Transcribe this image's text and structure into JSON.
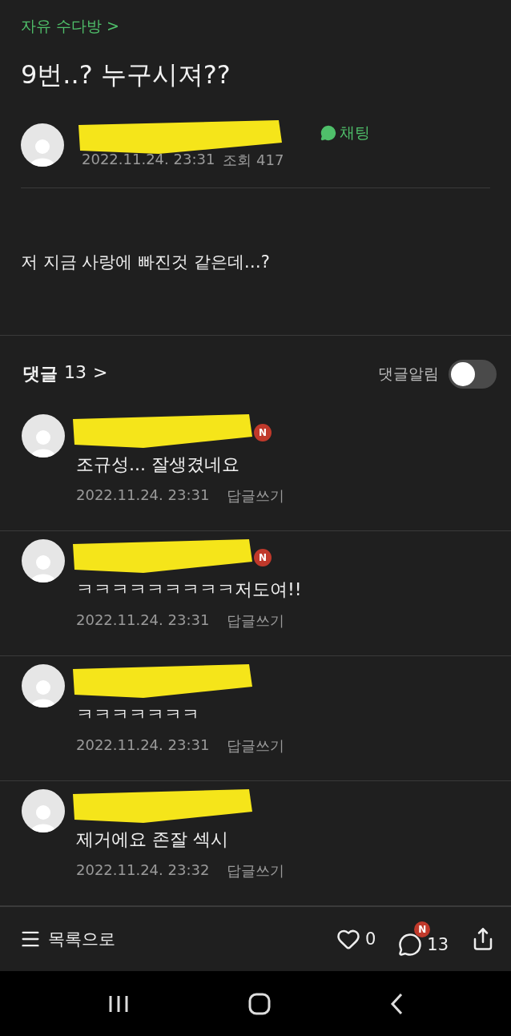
{
  "breadcrumb": {
    "label": "자유 수다방",
    "chevron": ">"
  },
  "post": {
    "title": "9번..? 누구시져??",
    "author": {
      "redacted": true
    },
    "chat_label": "채팅",
    "date": "2022.11.24. 23:31",
    "views": "조회 417",
    "body": "저 지금 사랑에 빠진것 같은데…?"
  },
  "comments_header": {
    "label": "댓글",
    "count": "13",
    "chevron": ">",
    "notify_label": "댓글알림",
    "notify_on": false
  },
  "comments": [
    {
      "author": {
        "redacted": true,
        "new": true
      },
      "new_badge": "N",
      "text": "조규성... 잘생겼네요",
      "date": "2022.11.24. 23:31",
      "reply": "답글쓰기"
    },
    {
      "author": {
        "redacted": true,
        "new": true
      },
      "new_badge": "N",
      "text": "ㅋㅋㅋㅋㅋㅋㅋㅋㅋ저도여!!",
      "date": "2022.11.24. 23:31",
      "reply": "답글쓰기"
    },
    {
      "author": {
        "redacted": true,
        "new": false
      },
      "text": "ㅋㅋㅋㅋㅋㅋㅋ",
      "date": "2022.11.24. 23:31",
      "reply": "답글쓰기"
    },
    {
      "author": {
        "redacted": true,
        "new": false
      },
      "text": "제거에요 존잘 섹시",
      "date": "2022.11.24. 23:32",
      "reply": "답글쓰기"
    }
  ],
  "bottom_bar": {
    "list_label": "목록으로",
    "likes": "0",
    "comment_badge": "N",
    "comments": "13"
  }
}
